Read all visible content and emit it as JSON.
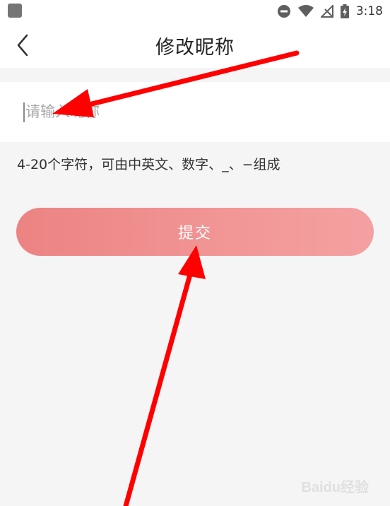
{
  "status_bar": {
    "time": "3:18"
  },
  "header": {
    "title": "修改昵称",
    "back_icon": "chevron-left-icon"
  },
  "form": {
    "nickname_placeholder": "请输入昵称",
    "nickname_value": "",
    "hint": "4-20个字符，可由中英文、数字、_、−组成",
    "submit_label": "提交"
  },
  "watermark": {
    "text": "Baidu经验"
  },
  "colors": {
    "button_start": "#ec8383",
    "button_end": "#f4a1a1",
    "annotation_arrow": "#ff0000",
    "background": "#f5f5f5"
  }
}
